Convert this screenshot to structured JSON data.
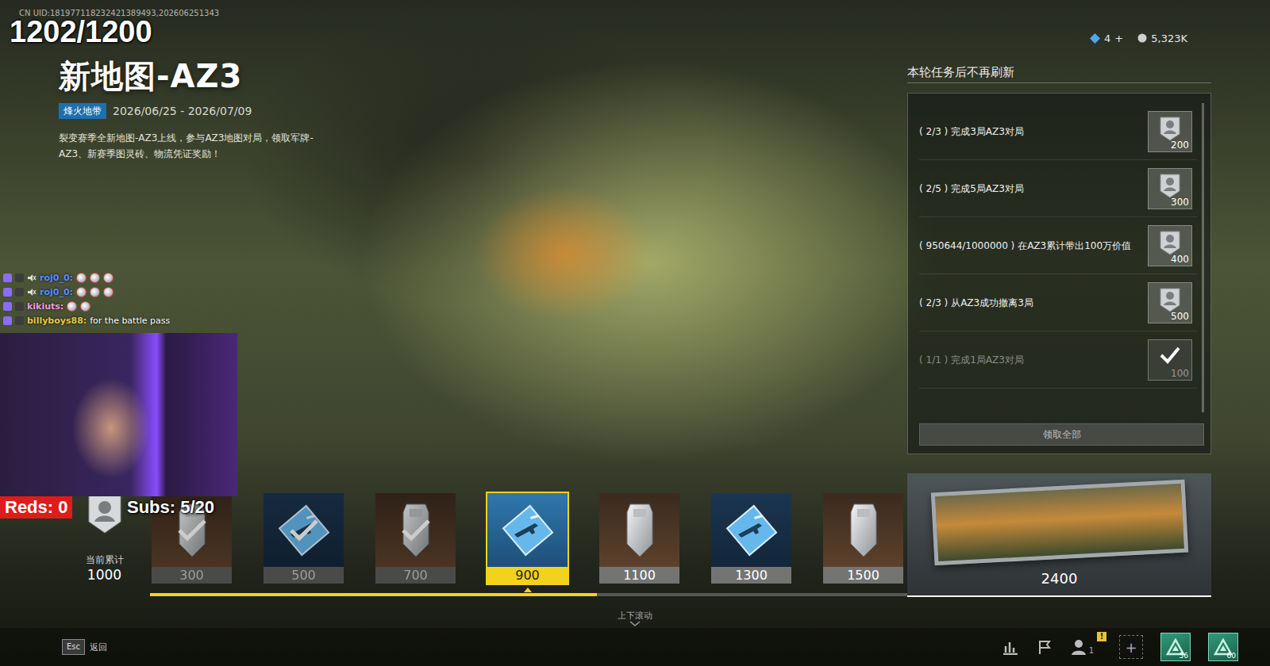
{
  "overlay": {
    "uid": "CN UID:181977118232421389493,202606251343",
    "counter": "1202/1200",
    "reds": "Reds: 0",
    "subs": "Subs: 5/20"
  },
  "chat": [
    {
      "user": "roj0_0:",
      "text": "",
      "muted": true,
      "emotes": 3,
      "color": "#5b8cff"
    },
    {
      "user": "roj0_0:",
      "text": "",
      "muted": true,
      "emotes": 3,
      "color": "#5b8cff"
    },
    {
      "user": "kikiuts:",
      "text": "",
      "muted": false,
      "emotes": 2,
      "color": "#f09ad8"
    },
    {
      "user": "billyboys88:",
      "text": "for the battle pass",
      "muted": false,
      "emotes": 0,
      "color": "#e6c84a"
    }
  ],
  "currency": {
    "gems": "4",
    "gems_add": "+",
    "coins": "5,323K"
  },
  "event": {
    "title": "新地图-AZ3",
    "tag": "烽火地带",
    "dates": "2026/06/25 - 2026/07/09",
    "description": "裂变赛季全新地图-AZ3上线，参与AZ3地图对局，领取军牌-AZ3、新赛季图灵砖、物流凭证奖励！"
  },
  "tasks": {
    "header": "本轮任务后不再刷新",
    "items": [
      {
        "progress": "( 2/3 )",
        "text": "完成3局AZ3对局",
        "reward": "200",
        "completed": false
      },
      {
        "progress": "( 2/5 )",
        "text": "完成5局AZ3对局",
        "reward": "300",
        "completed": false
      },
      {
        "progress": "( 950644/1000000 )",
        "text": "在AZ3累计带出100万价值",
        "reward": "400",
        "completed": false
      },
      {
        "progress": "( 2/3 )",
        "text": "从AZ3成功撤离3局",
        "reward": "500",
        "completed": false
      },
      {
        "progress": "( 1/1 )",
        "text": "完成1局AZ3对局",
        "reward": "100",
        "completed": true
      }
    ],
    "claim_all": "领取全部"
  },
  "track": {
    "accum_label": "当前累计",
    "accum_value": "1000",
    "level": 0.59,
    "rewards": [
      {
        "points": "300",
        "kind": "tag",
        "claimed": true,
        "selected": false
      },
      {
        "points": "500",
        "kind": "card",
        "claimed": true,
        "selected": false
      },
      {
        "points": "700",
        "kind": "tag",
        "claimed": true,
        "selected": false
      },
      {
        "points": "900",
        "kind": "card",
        "claimed": false,
        "selected": true
      },
      {
        "points": "1100",
        "kind": "tag",
        "claimed": false,
        "selected": false
      },
      {
        "points": "1300",
        "kind": "card",
        "claimed": false,
        "selected": false
      },
      {
        "points": "1500",
        "kind": "tag",
        "claimed": false,
        "selected": false
      }
    ],
    "final": {
      "points": "2400"
    }
  },
  "scroll_hint": "上下滚动",
  "bottom_bar": {
    "esc_key": "Esc",
    "back": "返回",
    "friends_count": "1",
    "alert": "!",
    "plus": "+",
    "badges": [
      "56",
      "60"
    ]
  }
}
